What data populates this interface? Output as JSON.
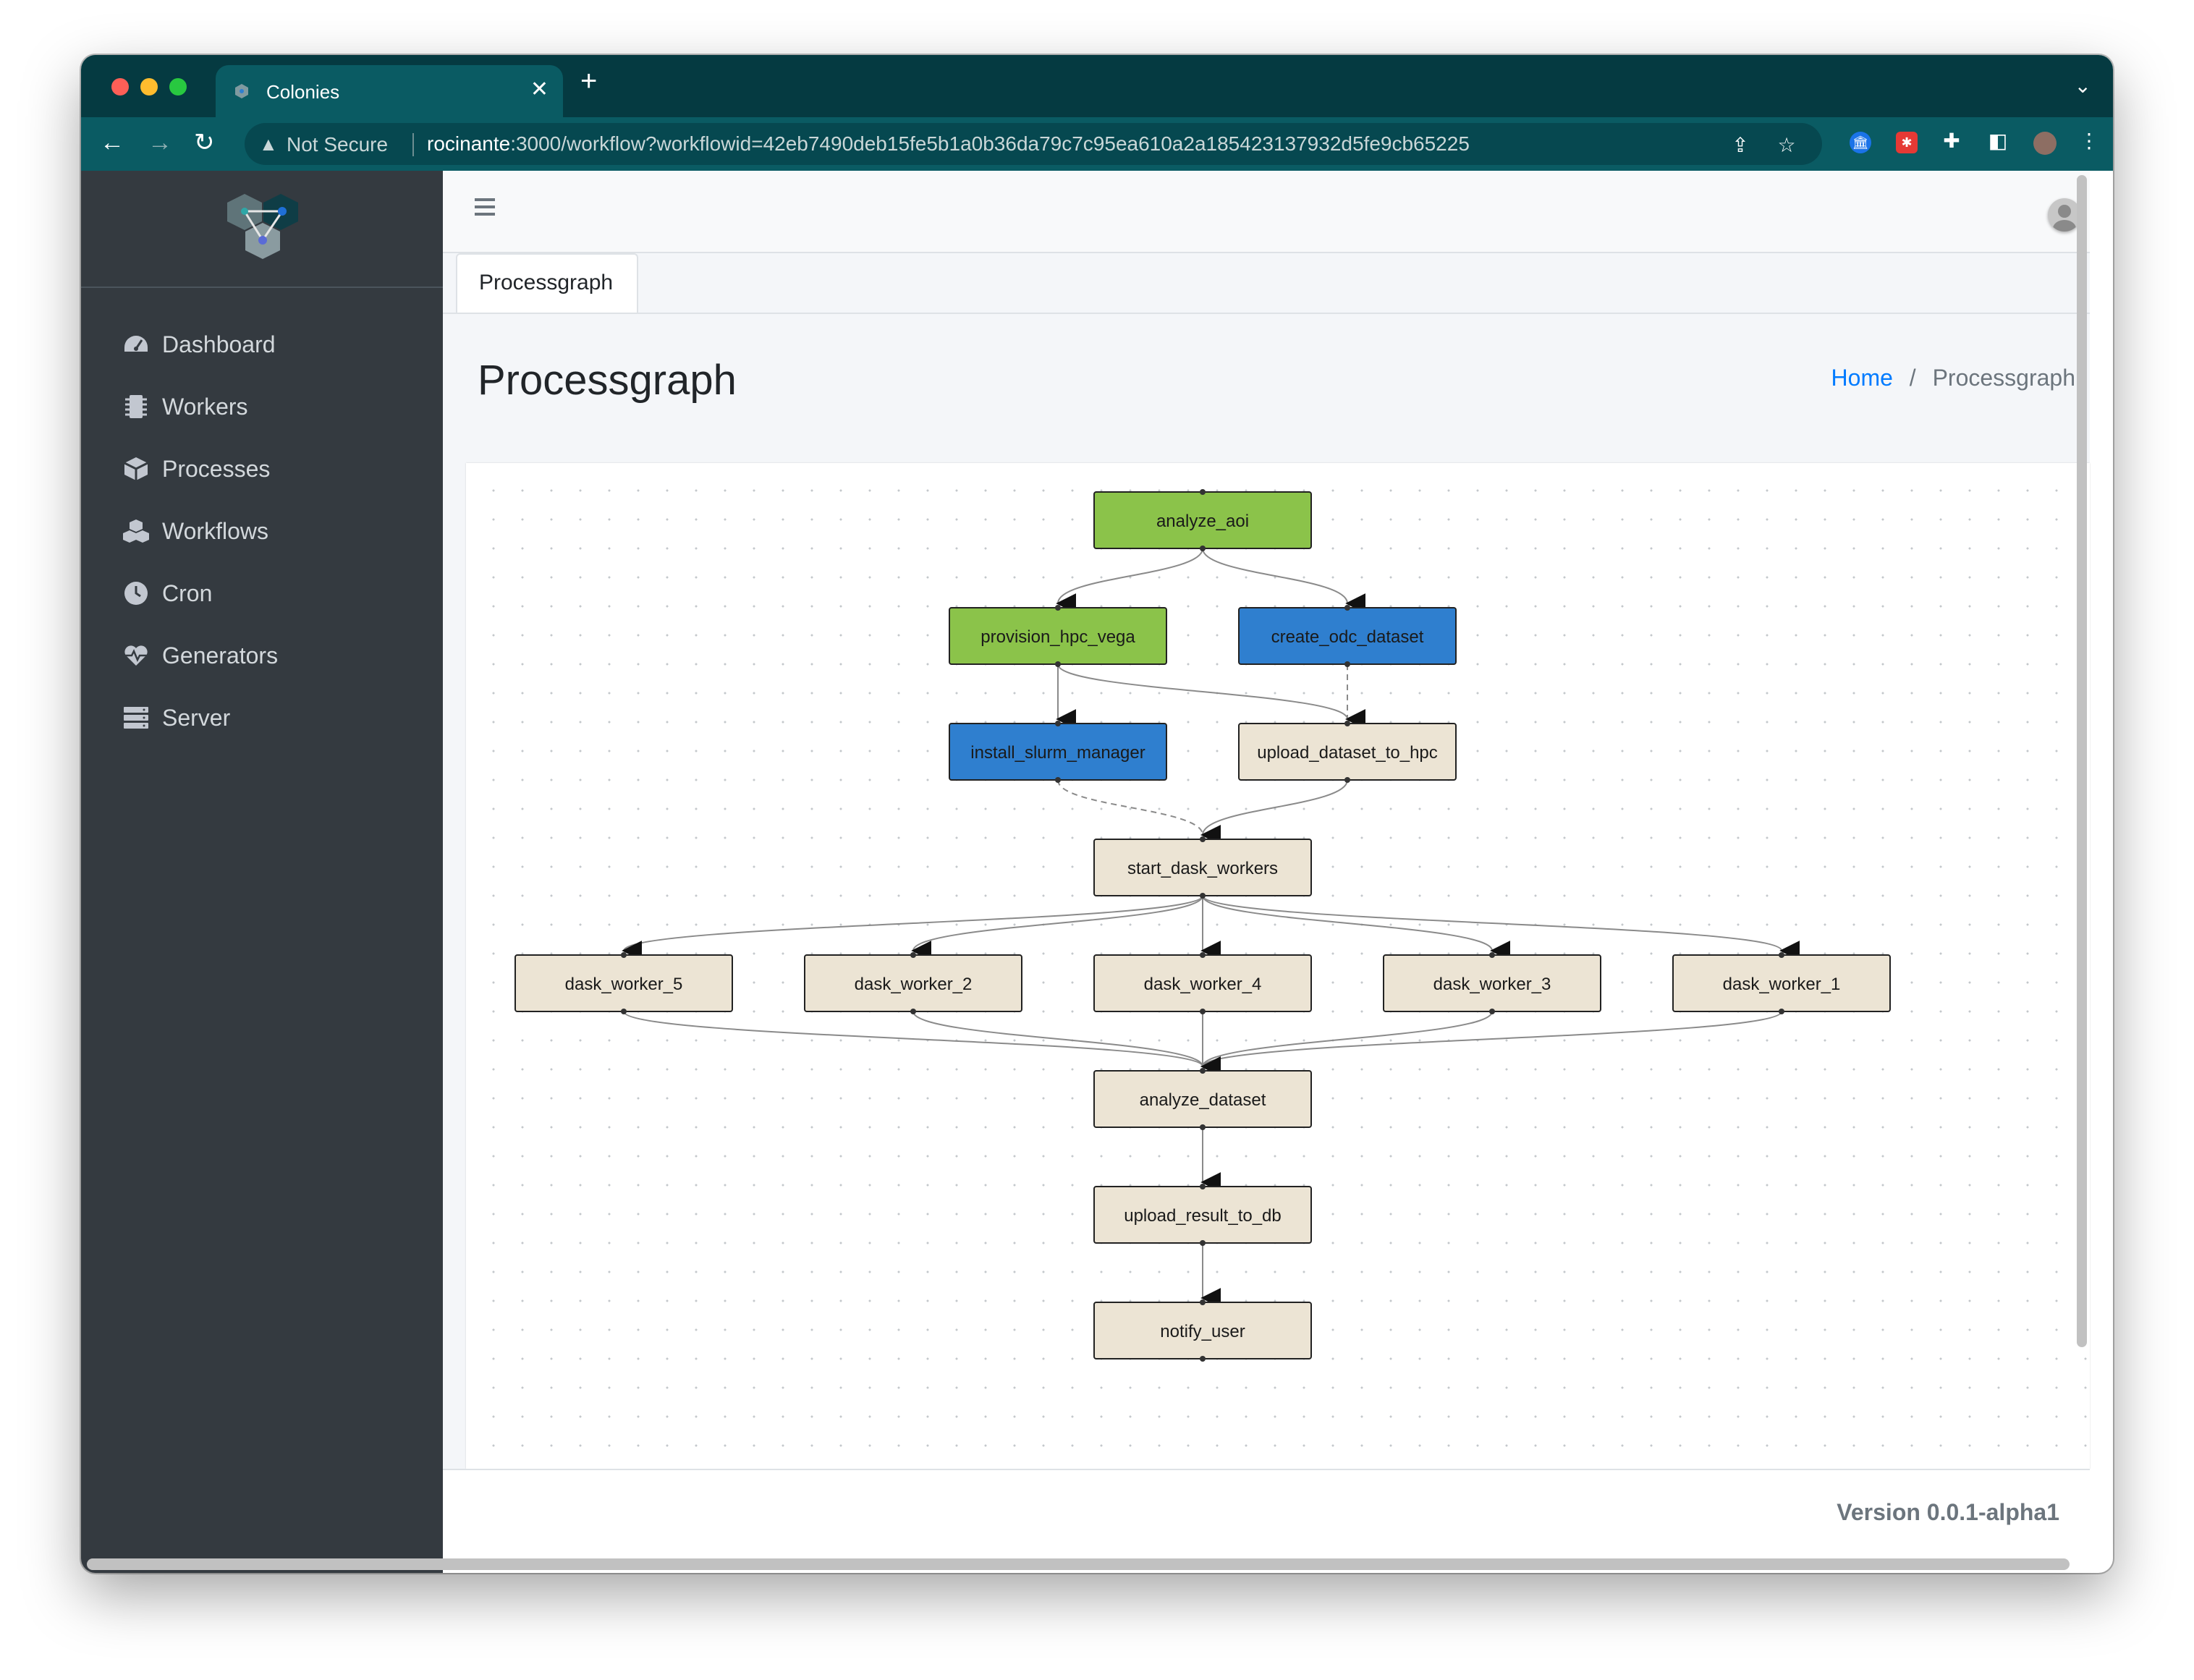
{
  "browser": {
    "tab_title": "Colonies",
    "security_label": "Not Secure",
    "url_host": "rocinante",
    "url_path": ":3000/workflow?workflowid=42eb7490deb15fe5b1a0b36da79c7c95ea610a2a185423137932d5fe9cb65225"
  },
  "sidebar": {
    "items": [
      {
        "label": "Dashboard",
        "icon": "dashboard-icon"
      },
      {
        "label": "Workers",
        "icon": "microchip-icon"
      },
      {
        "label": "Processes",
        "icon": "cube-icon"
      },
      {
        "label": "Workflows",
        "icon": "cubes-icon"
      },
      {
        "label": "Cron",
        "icon": "clock-icon"
      },
      {
        "label": "Generators",
        "icon": "heartbeat-icon"
      },
      {
        "label": "Server",
        "icon": "server-icon"
      }
    ]
  },
  "tabs": [
    "Processgraph"
  ],
  "page": {
    "title": "Processgraph",
    "breadcrumb": {
      "home": "Home",
      "separator": "/",
      "current": "Processgraph"
    }
  },
  "footer": {
    "version": "Version 0.0.1-alpha1"
  },
  "colors": {
    "success": "#8bc34a",
    "running": "#2f7fcf",
    "waiting": "#ece4d4",
    "sidebar": "#343a40",
    "chrome": "#0a5b63"
  },
  "graph": {
    "nodes": [
      {
        "id": "analyze_aoi",
        "label": "analyze_aoi",
        "state": "success"
      },
      {
        "id": "provision_hpc_vega",
        "label": "provision_hpc_vega",
        "state": "success"
      },
      {
        "id": "create_odc_dataset",
        "label": "create_odc_dataset",
        "state": "running"
      },
      {
        "id": "install_slurm_manager",
        "label": "install_slurm_manager",
        "state": "running"
      },
      {
        "id": "upload_dataset_to_hpc",
        "label": "upload_dataset_to_hpc",
        "state": "waiting"
      },
      {
        "id": "start_dask_workers",
        "label": "start_dask_workers",
        "state": "waiting"
      },
      {
        "id": "dask_worker_5",
        "label": "dask_worker_5",
        "state": "waiting"
      },
      {
        "id": "dask_worker_2",
        "label": "dask_worker_2",
        "state": "waiting"
      },
      {
        "id": "dask_worker_4",
        "label": "dask_worker_4",
        "state": "waiting"
      },
      {
        "id": "dask_worker_3",
        "label": "dask_worker_3",
        "state": "waiting"
      },
      {
        "id": "dask_worker_1",
        "label": "dask_worker_1",
        "state": "waiting"
      },
      {
        "id": "analyze_dataset",
        "label": "analyze_dataset",
        "state": "waiting"
      },
      {
        "id": "upload_result_to_db",
        "label": "upload_result_to_db",
        "state": "waiting"
      },
      {
        "id": "notify_user",
        "label": "notify_user",
        "state": "waiting"
      }
    ],
    "edges": [
      {
        "from": "analyze_aoi",
        "to": "provision_hpc_vega"
      },
      {
        "from": "analyze_aoi",
        "to": "create_odc_dataset"
      },
      {
        "from": "provision_hpc_vega",
        "to": "install_slurm_manager"
      },
      {
        "from": "provision_hpc_vega",
        "to": "upload_dataset_to_hpc"
      },
      {
        "from": "create_odc_dataset",
        "to": "upload_dataset_to_hpc",
        "dashed": true
      },
      {
        "from": "install_slurm_manager",
        "to": "start_dask_workers",
        "dashed": true
      },
      {
        "from": "upload_dataset_to_hpc",
        "to": "start_dask_workers"
      },
      {
        "from": "start_dask_workers",
        "to": "dask_worker_5"
      },
      {
        "from": "start_dask_workers",
        "to": "dask_worker_2"
      },
      {
        "from": "start_dask_workers",
        "to": "dask_worker_4"
      },
      {
        "from": "start_dask_workers",
        "to": "dask_worker_3"
      },
      {
        "from": "start_dask_workers",
        "to": "dask_worker_1"
      },
      {
        "from": "dask_worker_5",
        "to": "analyze_dataset"
      },
      {
        "from": "dask_worker_2",
        "to": "analyze_dataset"
      },
      {
        "from": "dask_worker_4",
        "to": "analyze_dataset"
      },
      {
        "from": "dask_worker_3",
        "to": "analyze_dataset"
      },
      {
        "from": "dask_worker_1",
        "to": "analyze_dataset"
      },
      {
        "from": "analyze_dataset",
        "to": "upload_result_to_db"
      },
      {
        "from": "upload_result_to_db",
        "to": "notify_user"
      }
    ]
  }
}
